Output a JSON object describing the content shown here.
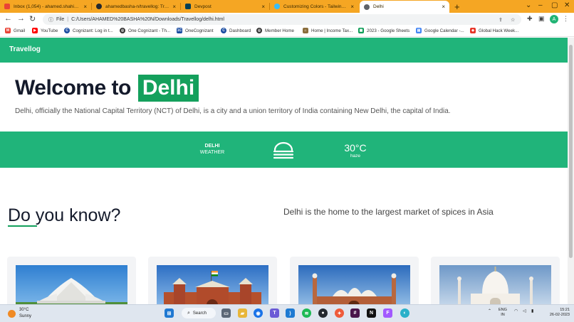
{
  "browser": {
    "tabs": [
      {
        "label": "Inbox (1,054) - ahamed.shahinsh",
        "color": "#ea4335"
      },
      {
        "label": "ahamedbasha-n/travellog: Trave",
        "color": "#24292f"
      },
      {
        "label": "Devpost",
        "color": "#003e54"
      },
      {
        "label": "Customizing Colors - Tailwind C",
        "color": "#38bdf8"
      },
      {
        "label": "Delhi",
        "color": "#5f6368"
      }
    ],
    "address": {
      "prefix": "File",
      "url": "C:/Users/AHAMED%20BASHA%20N/Downloads/Travellog/delhi.html"
    },
    "profile_initial": "A",
    "bookmarks": [
      {
        "label": "Gmail",
        "color": "#ea4335"
      },
      {
        "label": "YouTube",
        "color": "#ff0000"
      },
      {
        "label": "Cognizant: Log in t...",
        "color": "#1a4ca1"
      },
      {
        "label": "One Cognizant - Th...",
        "color": "#333333"
      },
      {
        "label": "OneCognizant",
        "color": "#1a4ca1"
      },
      {
        "label": "Dashboard",
        "color": "#1a4ca1"
      },
      {
        "label": "Member Home",
        "color": "#333333"
      },
      {
        "label": "Home | Income Tax...",
        "color": "#8a6d3b"
      },
      {
        "label": "2023 - Google Sheets",
        "color": "#0f9d58"
      },
      {
        "label": "Google Calendar -...",
        "color": "#4285f4"
      },
      {
        "label": "Global Hack Week...",
        "color": "#e73427"
      }
    ]
  },
  "page": {
    "brand": "Travellog",
    "hero": {
      "welcome": "Welcome to",
      "city": "Delhi",
      "description": "Delhi, officially the National Capital Territory (NCT) of Delhi, is a city and a union territory of India containing New Delhi, the capital of India."
    },
    "weather": {
      "city": "DELHI",
      "label": "WEATHER",
      "icon": "haze-icon",
      "temperature": "30°C",
      "condition": "haze"
    },
    "did_you_know": {
      "heading": "Do you know?",
      "fact": "Delhi is the home to the largest market of spices in Asia"
    },
    "cards": [
      {
        "name": "lotus-temple"
      },
      {
        "name": "red-fort"
      },
      {
        "name": "jama-masjid"
      },
      {
        "name": "taj-mahal"
      }
    ],
    "colors": {
      "accent": "#20b47a",
      "highlight": "#14a05c",
      "heading": "#141a2b"
    }
  },
  "taskbar": {
    "weather_temp": "30°C",
    "weather_cond": "Sunny",
    "search_label": "Search",
    "lang_line1": "ENG",
    "lang_line2": "IN",
    "time": "15:21",
    "date": "26-02-2023"
  }
}
